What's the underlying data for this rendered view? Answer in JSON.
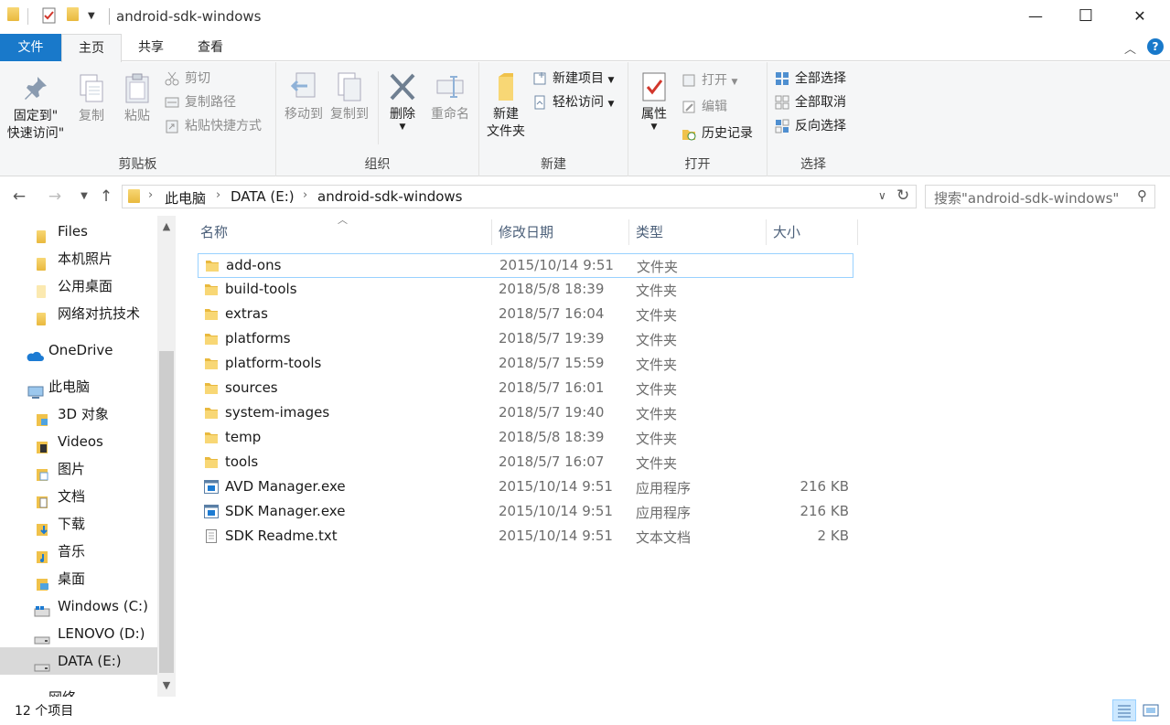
{
  "window": {
    "title": "android-sdk-windows",
    "minimize_glyph": "—",
    "maximize_glyph": "☐",
    "close_glyph": "✕"
  },
  "ribbon_tabs": {
    "file": "文件",
    "home": "主页",
    "share": "共享",
    "view": "查看"
  },
  "ribbon": {
    "clipboard": {
      "label": "剪贴板",
      "pin_line1": "固定到\"",
      "pin_line2": "快速访问\"",
      "copy": "复制",
      "paste": "粘贴",
      "cut": "剪切",
      "copy_path": "复制路径",
      "paste_shortcut": "粘贴快捷方式"
    },
    "organize": {
      "label": "组织",
      "move_to": "移动到",
      "copy_to": "复制到",
      "delete": "删除",
      "rename": "重命名"
    },
    "new": {
      "label": "新建",
      "new_folder_line1": "新建",
      "new_folder_line2": "文件夹",
      "new_item": "新建项目",
      "easy_access": "轻松访问"
    },
    "open": {
      "label": "打开",
      "properties": "属性",
      "open": "打开",
      "edit": "编辑",
      "history": "历史记录"
    },
    "select": {
      "label": "选择",
      "select_all": "全部选择",
      "select_none": "全部取消",
      "invert": "反向选择"
    }
  },
  "address": {
    "crumbs": [
      "此电脑",
      "DATA (E:)",
      "android-sdk-windows"
    ],
    "search_placeholder": "搜索\"android-sdk-windows\""
  },
  "nav": {
    "items": [
      {
        "label": "Files",
        "icon": "folder-icon"
      },
      {
        "label": "本机照片",
        "icon": "folder-icon"
      },
      {
        "label": "公用桌面",
        "icon": "folder-icon"
      },
      {
        "label": "网络对抗技术",
        "icon": "folder-icon"
      },
      {
        "label": "OneDrive",
        "icon": "cloud-icon"
      },
      {
        "label": "此电脑",
        "icon": "computer-icon"
      },
      {
        "label": "3D 对象",
        "icon": "folder-3d-icon"
      },
      {
        "label": "Videos",
        "icon": "video-folder-icon"
      },
      {
        "label": "图片",
        "icon": "pictures-folder-icon"
      },
      {
        "label": "文档",
        "icon": "documents-folder-icon"
      },
      {
        "label": "下载",
        "icon": "downloads-folder-icon"
      },
      {
        "label": "音乐",
        "icon": "music-folder-icon"
      },
      {
        "label": "桌面",
        "icon": "desktop-folder-icon"
      },
      {
        "label": "Windows (C:)",
        "icon": "windows-drive-icon"
      },
      {
        "label": "LENOVO (D:)",
        "icon": "drive-icon"
      },
      {
        "label": "DATA (E:)",
        "icon": "drive-icon"
      },
      {
        "label": "网络",
        "icon": "network-icon"
      }
    ]
  },
  "list": {
    "columns": {
      "name": "名称",
      "date": "修改日期",
      "type": "类型",
      "size": "大小"
    },
    "rows": [
      {
        "name": "add-ons",
        "date": "2015/10/14 9:51",
        "type": "文件夹",
        "size": "",
        "icon": "folder-icon"
      },
      {
        "name": "build-tools",
        "date": "2018/5/8 18:39",
        "type": "文件夹",
        "size": "",
        "icon": "folder-icon"
      },
      {
        "name": "extras",
        "date": "2018/5/7 16:04",
        "type": "文件夹",
        "size": "",
        "icon": "folder-icon"
      },
      {
        "name": "platforms",
        "date": "2018/5/7 19:39",
        "type": "文件夹",
        "size": "",
        "icon": "folder-icon"
      },
      {
        "name": "platform-tools",
        "date": "2018/5/7 15:59",
        "type": "文件夹",
        "size": "",
        "icon": "folder-icon"
      },
      {
        "name": "sources",
        "date": "2018/5/7 16:01",
        "type": "文件夹",
        "size": "",
        "icon": "folder-icon"
      },
      {
        "name": "system-images",
        "date": "2018/5/7 19:40",
        "type": "文件夹",
        "size": "",
        "icon": "folder-icon"
      },
      {
        "name": "temp",
        "date": "2018/5/8 18:39",
        "type": "文件夹",
        "size": "",
        "icon": "folder-icon"
      },
      {
        "name": "tools",
        "date": "2018/5/7 16:07",
        "type": "文件夹",
        "size": "",
        "icon": "folder-icon"
      },
      {
        "name": "AVD Manager.exe",
        "date": "2015/10/14 9:51",
        "type": "应用程序",
        "size": "216 KB",
        "icon": "exe-icon"
      },
      {
        "name": "SDK Manager.exe",
        "date": "2015/10/14 9:51",
        "type": "应用程序",
        "size": "216 KB",
        "icon": "exe-icon"
      },
      {
        "name": "SDK Readme.txt",
        "date": "2015/10/14 9:51",
        "type": "文本文档",
        "size": "2 KB",
        "icon": "text-file-icon"
      }
    ]
  },
  "status": {
    "count": "12 个项目"
  },
  "colors": {
    "accent": "#1979ca",
    "folder": "#f0c24b",
    "selection": "#d9d9d9",
    "focus_border": "#99d1ff"
  }
}
